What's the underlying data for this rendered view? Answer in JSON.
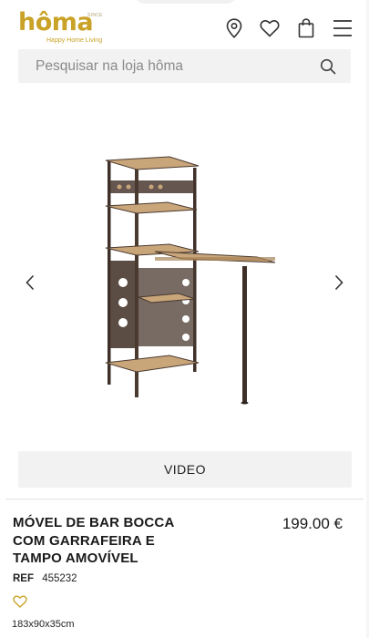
{
  "header": {
    "logo_text": "hôma",
    "logo_since": "SINCE",
    "logo_tagline": "Happy Home Living",
    "icons": [
      "location-icon",
      "heart-icon",
      "shopping-bag-icon",
      "menu-icon"
    ]
  },
  "search": {
    "placeholder": "Pesquisar na loja hôma"
  },
  "gallery": {
    "prev_icon": "chevron-left-icon",
    "next_icon": "chevron-right-icon"
  },
  "video_button": "VIDEO",
  "product": {
    "title": "MÓVEL DE BAR BOCCA COM GARRAFEIRA E TAMPO AMOVÍVEL",
    "price": "199.00 €",
    "ref_label": "REF",
    "ref_value": "455232",
    "dimensions": "183x90x35cm"
  },
  "colors": {
    "brand_gold": "#c9a227",
    "metal": "#4a3a30",
    "wood": "#c9a57a"
  }
}
